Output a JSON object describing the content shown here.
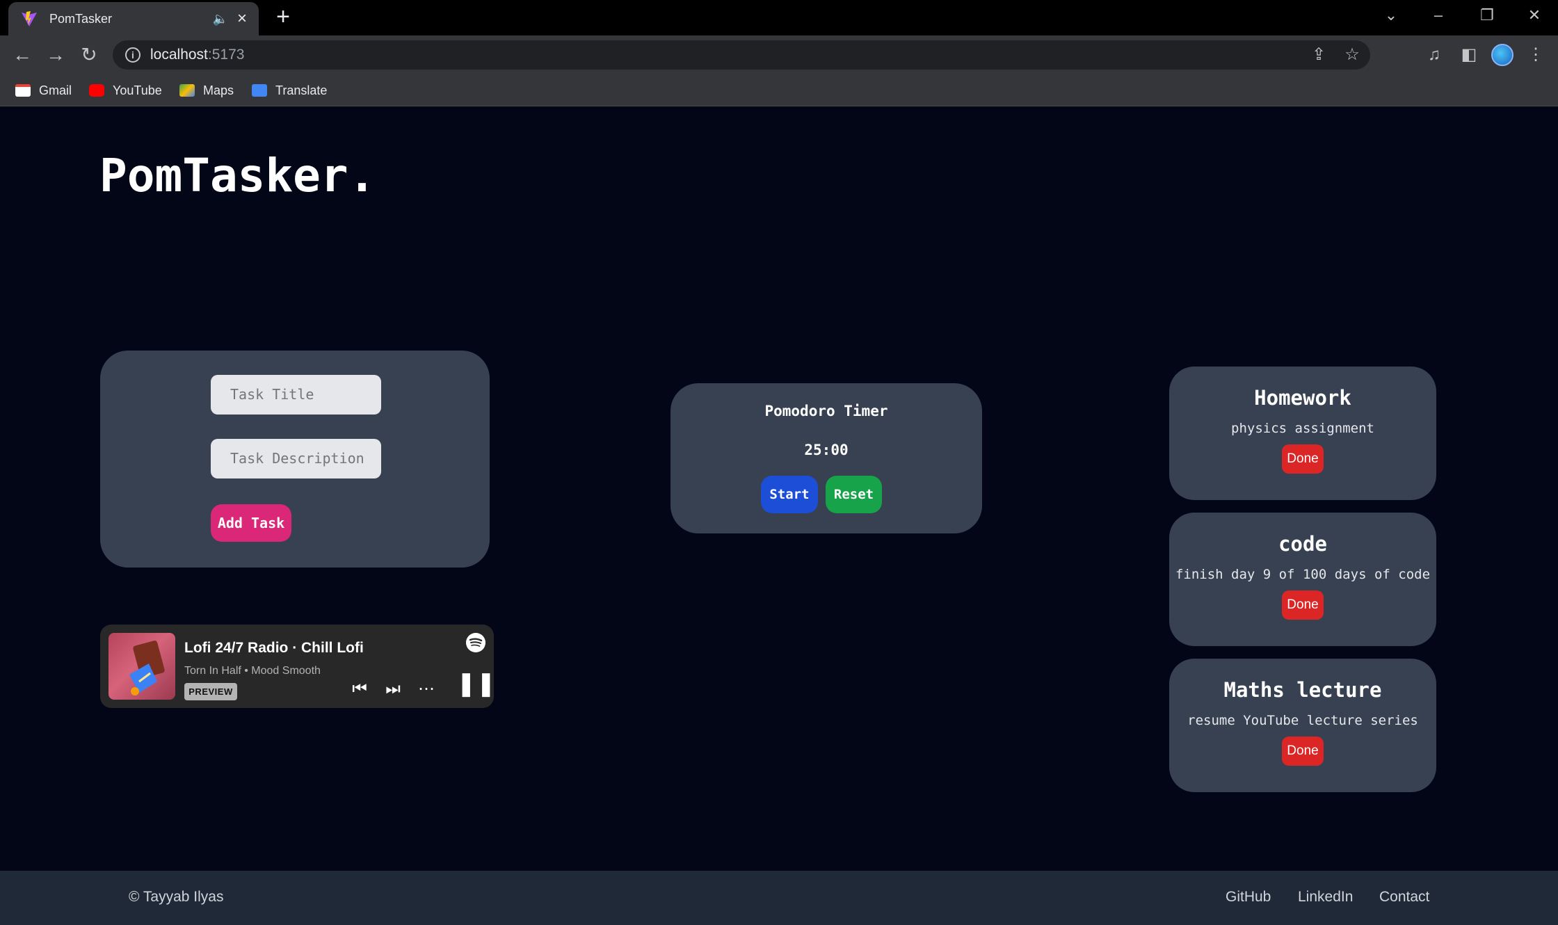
{
  "browser": {
    "tab_title": "PomTasker",
    "url_host": "localhost",
    "url_port": ":5173",
    "bookmarks": [
      {
        "label": "Gmail",
        "icon": "gmail-icon"
      },
      {
        "label": "YouTube",
        "icon": "youtube-icon"
      },
      {
        "label": "Maps",
        "icon": "maps-icon"
      },
      {
        "label": "Translate",
        "icon": "translate-icon"
      }
    ]
  },
  "app": {
    "brand": "PomTasker.",
    "form": {
      "title_placeholder": "Task Title",
      "description_placeholder": "Task Description",
      "add_label": "Add Task"
    },
    "timer": {
      "title": "Pomodoro Timer",
      "time": "25:00",
      "start_label": "Start",
      "reset_label": "Reset"
    },
    "tasks": [
      {
        "title": "Homework",
        "description": "physics assignment",
        "done_label": "Done"
      },
      {
        "title": "code",
        "description": "finish day 9 of 100 days of code",
        "done_label": "Done"
      },
      {
        "title": "Maths lecture",
        "description": "resume YouTube lecture series",
        "done_label": "Done"
      }
    ],
    "spotify": {
      "title": "Lofi 24/7 Radio · Chill Lofi",
      "artist": "Torn In Half • Mood Smooth",
      "badge": "PREVIEW"
    }
  },
  "footer": {
    "copyright": "© Tayyab Ilyas",
    "links": [
      "GitHub",
      "LinkedIn",
      "Contact"
    ]
  },
  "colors": {
    "page_bg": "#020617",
    "card_bg": "#374151",
    "add_button": "#db2777",
    "start_button": "#1d4ed8",
    "reset_button": "#16a34a",
    "done_button": "#dc2626",
    "footer_bg": "#1f2937"
  }
}
